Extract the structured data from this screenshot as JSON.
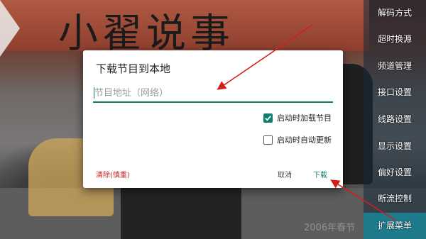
{
  "background": {
    "banner_text": "小翟说事",
    "footer_text": "2006年春节"
  },
  "dialog": {
    "title": "下载节目到本地",
    "input_value": "",
    "input_placeholder": "节目地址（网络）",
    "checkbox_load_on_start": {
      "label": "启动时加载节目",
      "checked": true
    },
    "checkbox_auto_update": {
      "label": "启动时自动更新",
      "checked": false
    },
    "clear_label": "清除(慎重)",
    "cancel_label": "取消",
    "download_label": "下载",
    "accent_color": "#0d7d6d",
    "danger_color": "#c62828"
  },
  "side_menu": {
    "items": [
      {
        "label": "解码方式"
      },
      {
        "label": "超时换源"
      },
      {
        "label": "频道管理"
      },
      {
        "label": "接口设置"
      },
      {
        "label": "线路设置"
      },
      {
        "label": "显示设置"
      },
      {
        "label": "偏好设置"
      },
      {
        "label": "断流控制"
      },
      {
        "label": "扩展菜单",
        "selected": true
      }
    ]
  },
  "annotation_color": "#d0201a"
}
